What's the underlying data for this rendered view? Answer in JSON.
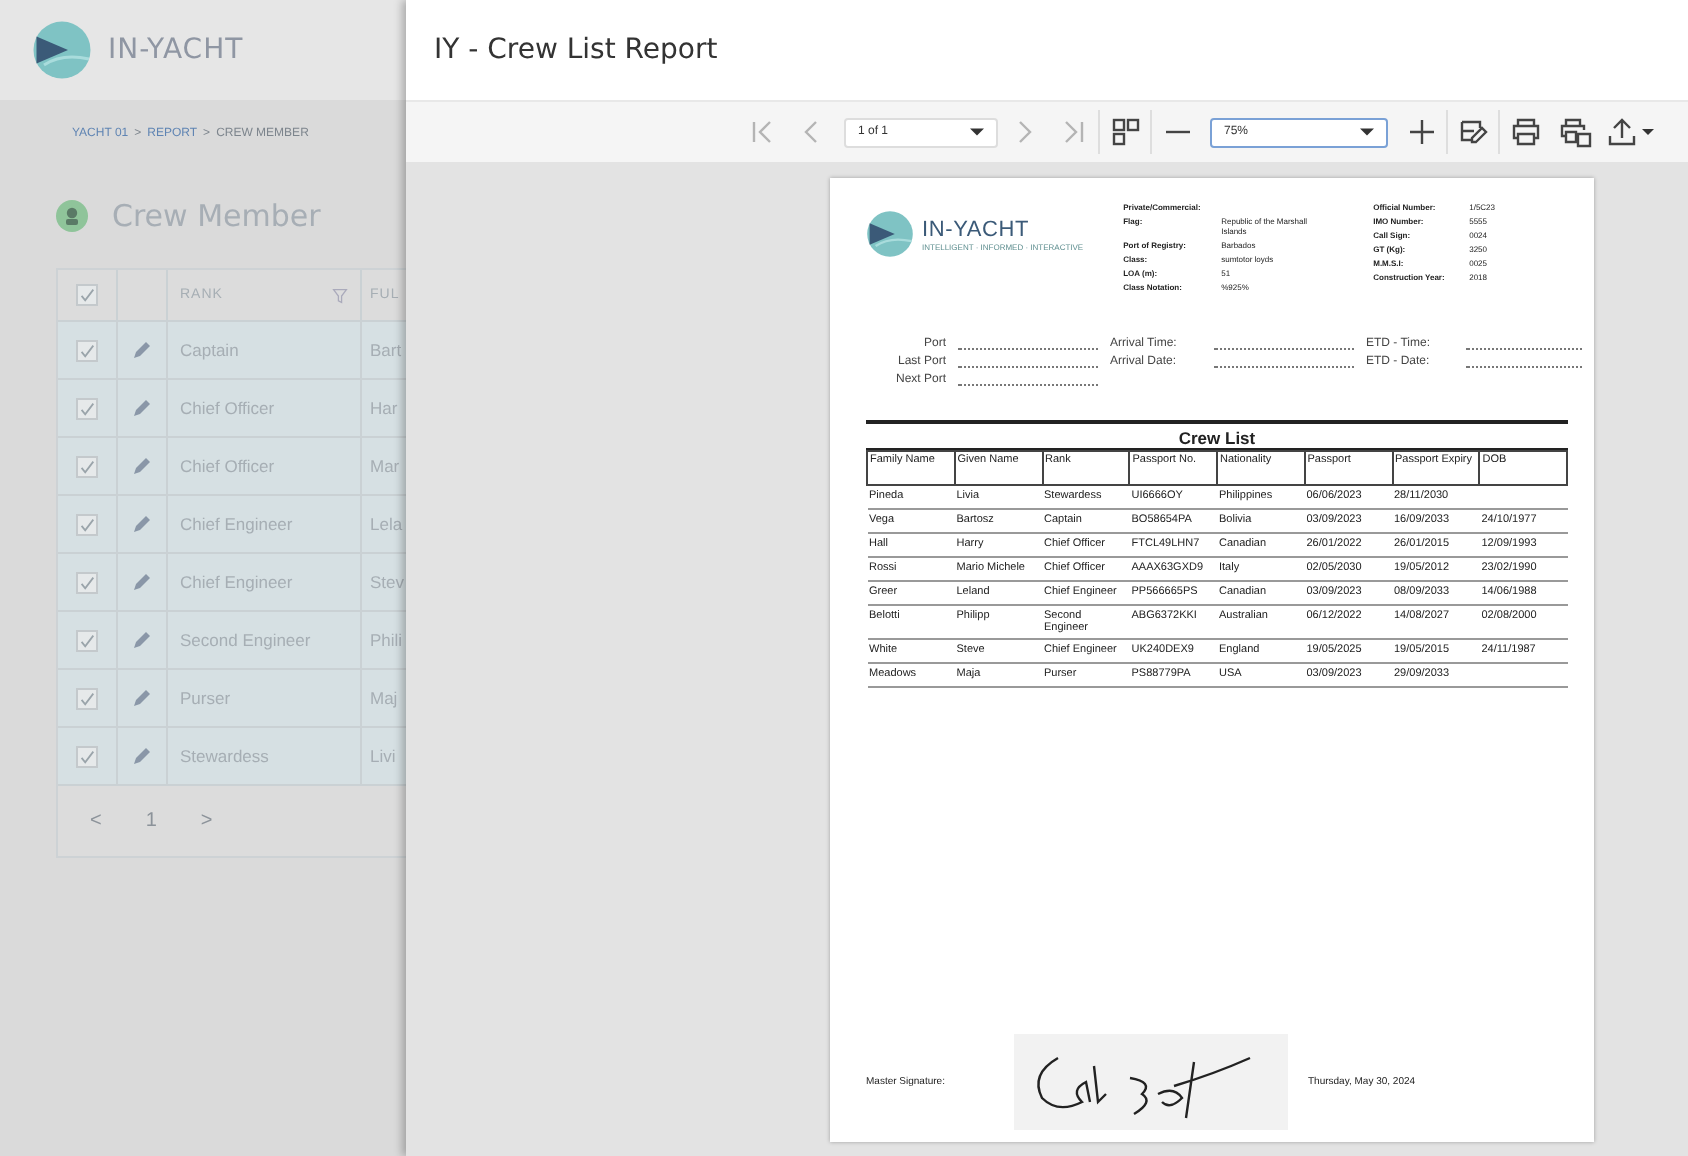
{
  "app": {
    "logo_text": "IN-YACHT",
    "breadcrumb": [
      {
        "kind": "link",
        "label": "YACHT 01"
      },
      {
        "kind": "separator",
        "label": ">"
      },
      {
        "kind": "link",
        "label": "REPORT"
      },
      {
        "kind": "separator",
        "label": ">"
      },
      {
        "kind": "current",
        "label": "CREW MEMBER"
      }
    ],
    "page_title": "Crew Member",
    "table": {
      "header_checked": true,
      "columns": [
        "RANK",
        "FUL"
      ],
      "rows": [
        {
          "checked": true,
          "rank": "Captain",
          "column_2": "Bart"
        },
        {
          "checked": true,
          "rank": "Chief Officer",
          "column_2": "Har"
        },
        {
          "checked": true,
          "rank": "Chief Officer",
          "column_2": "Mar"
        },
        {
          "checked": true,
          "rank": "Chief Engineer",
          "column_2": "Lela"
        },
        {
          "checked": true,
          "rank": "Chief Engineer",
          "column_2": "Stev"
        },
        {
          "checked": true,
          "rank": "Second Engineer",
          "column_2": "Phili"
        },
        {
          "checked": true,
          "rank": "Purser",
          "column_2": "Maj"
        },
        {
          "checked": true,
          "rank": "Stewardess",
          "column_2": "Livi"
        }
      ]
    },
    "pager": {
      "prev": "<",
      "page": "1",
      "next": ">"
    }
  },
  "viewer": {
    "title": "IY - Crew List Report",
    "toolbar": [
      {
        "kind": "first-page",
        "disabled": true
      },
      {
        "kind": "prev-page",
        "disabled": true
      },
      {
        "kind": "page-select",
        "value": "1 of 1"
      },
      {
        "kind": "next-page",
        "disabled": true
      },
      {
        "kind": "last-page",
        "disabled": true
      },
      {
        "kind": "multi-page",
        "disabled": false
      },
      {
        "kind": "zoom-out",
        "disabled": false
      },
      {
        "kind": "zoom-select",
        "value": "75%"
      },
      {
        "kind": "zoom-in",
        "disabled": false
      },
      {
        "kind": "parameters",
        "disabled": false
      },
      {
        "kind": "print",
        "disabled": false
      },
      {
        "kind": "print-page",
        "disabled": false
      },
      {
        "kind": "export",
        "disabled": false
      }
    ],
    "document": {
      "logo_text": "IN-YACHT",
      "logo_tagline": "INTELLIGENT · INFORMED · INTERACTIVE",
      "vessel_left": [
        {
          "label": "Private/Commercial:"
        },
        {
          "label": "Flag:",
          "value": "Republic of the Marshall Islands"
        },
        {
          "label": "Port of Registry:",
          "value": "Barbados"
        },
        {
          "label": "Class:",
          "value": "sumtotor loyds"
        },
        {
          "label": "LOA (m):",
          "value": "51"
        },
        {
          "label": "Class Notation:",
          "value": "%925%"
        }
      ],
      "vessel_right": [
        {
          "label": "Official Number:",
          "value": "1/5C23"
        },
        {
          "label": "IMO Number:",
          "value": "5555"
        },
        {
          "label": "Call Sign:",
          "value": "0024"
        },
        {
          "label": "GT (Kg):",
          "value": "3250"
        },
        {
          "label": "M.M.S.I:",
          "value": "0025"
        },
        {
          "label": "Construction Year:",
          "value": "2018"
        }
      ],
      "port_rows": [
        {
          "col_1": "Port",
          "col_2": "Arrival Time:",
          "col_3": "ETD - Time:"
        },
        {
          "col_1": "Last Port",
          "col_2": "Arrival Date:",
          "col_3": "ETD - Date:"
        },
        {
          "col_1": "Next Port"
        }
      ],
      "crew_title": "Crew List",
      "crew_columns": [
        "Family Name",
        "Given Name",
        "Rank",
        "Passport No.",
        "Nationality",
        "Passport",
        "Passport Expiry",
        "DOB"
      ],
      "crew_rows": [
        [
          "Pineda",
          "Livia",
          "Stewardess",
          "UI6666OY",
          "Philippines",
          "06/06/2023",
          "28/11/2030",
          ""
        ],
        [
          "Vega",
          "Bartosz",
          "Captain",
          "BO58654PA",
          "Bolivia",
          "03/09/2023",
          "16/09/2033",
          "24/10/1977"
        ],
        [
          "Hall",
          "Harry",
          "Chief Officer",
          "FTCL49LHN7",
          "Canadian",
          "26/01/2022",
          "26/01/2015",
          "12/09/1993"
        ],
        [
          "Rossi",
          "Mario Michele",
          "Chief Officer",
          "AAAX63GXD9",
          "Italy",
          "02/05/2030",
          "19/05/2012",
          "23/02/1990"
        ],
        [
          "Greer",
          "Leland",
          "Chief Engineer",
          "PP566665PS",
          "Canadian",
          "03/09/2023",
          "08/09/2033",
          "14/06/1988"
        ],
        [
          "Belotti",
          "Philipp",
          "Second Engineer",
          "ABG6372KKI",
          "Australian",
          "06/12/2022",
          "14/08/2027",
          "02/08/2000"
        ],
        [
          "White",
          "Steve",
          "Chief Engineer",
          "UK240DEX9",
          "England",
          "19/05/2025",
          "19/05/2015",
          "24/11/1987"
        ],
        [
          "Meadows",
          "Maja",
          "Purser",
          "PS88779PA",
          "USA",
          "03/09/2023",
          "29/09/2033",
          ""
        ]
      ],
      "signature_label": "Master Signature:",
      "signature_date": "Thursday, May 30, 2024"
    }
  }
}
